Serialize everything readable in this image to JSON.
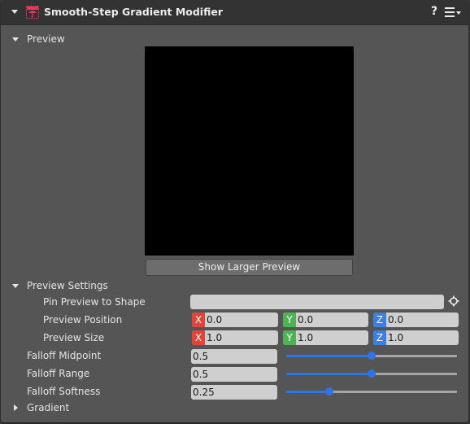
{
  "header": {
    "title": "Smooth-Step Gradient Modifier",
    "icon": "component-gradient-icon",
    "help_label": "?",
    "menu_icon": "hamburger-menu-icon"
  },
  "preview": {
    "section_label": "Preview",
    "expanded": true,
    "button_label": "Show Larger Preview"
  },
  "preview_settings": {
    "section_label": "Preview Settings",
    "expanded": true,
    "pin_label": "Pin Preview to Shape",
    "pin_value": "",
    "position_label": "Preview Position",
    "position": {
      "x_label": "X",
      "x": "0.0",
      "y_label": "Y",
      "y": "0.0",
      "z_label": "Z",
      "z": "0.0"
    },
    "size_label": "Preview Size",
    "size": {
      "x_label": "X",
      "x": "1.0",
      "y_label": "Y",
      "y": "1.0",
      "z_label": "Z",
      "z": "1.0"
    }
  },
  "falloff": {
    "midpoint_label": "Falloff Midpoint",
    "midpoint": "0.5",
    "midpoint_fraction": 0.5,
    "range_label": "Falloff Range",
    "range": "0.5",
    "range_fraction": 0.5,
    "softness_label": "Falloff Softness",
    "softness": "0.25",
    "softness_fraction": 0.25
  },
  "gradient": {
    "section_label": "Gradient",
    "expanded": false
  },
  "colors": {
    "accent": "#2e74e6",
    "x_axis": "#e0453c",
    "y_axis": "#4fb356",
    "z_axis": "#3b7fe0",
    "icon": "#e0395f"
  }
}
